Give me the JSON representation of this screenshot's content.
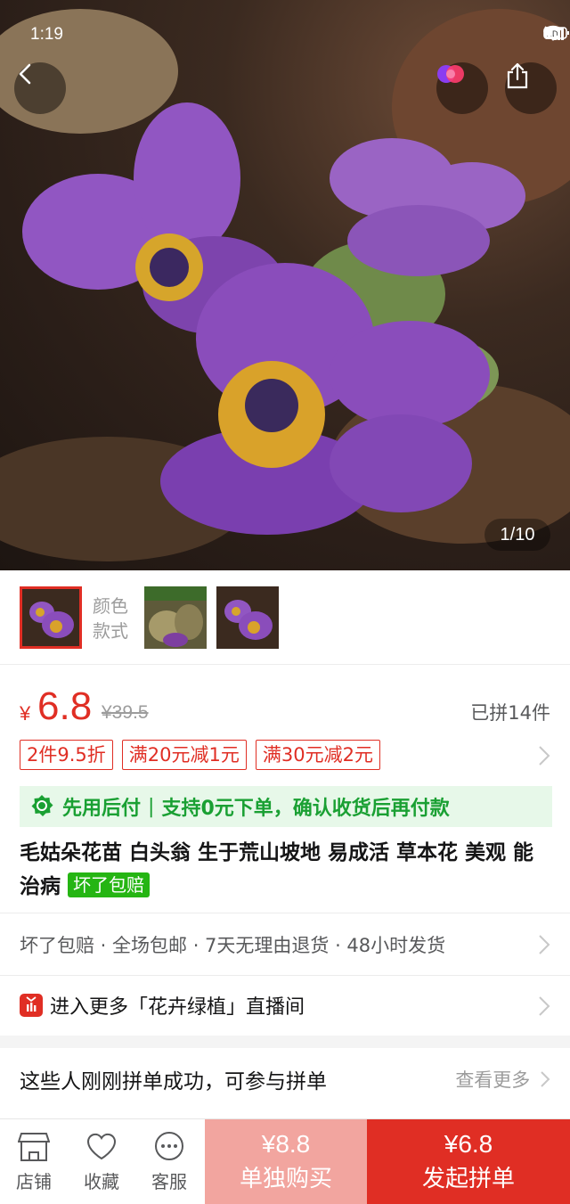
{
  "status_bar": {
    "time": "1:19"
  },
  "gallery": {
    "counter": "1/10"
  },
  "variant": {
    "label_line1": "颜色",
    "label_line2": "款式"
  },
  "price": {
    "currency": "¥",
    "current": "6.8",
    "original": "¥39.5",
    "sold": "已拼14件"
  },
  "promo_tags": [
    "2件9.5折",
    "满20元减1元",
    "满30元减2元"
  ],
  "pay_later": {
    "title": "先用后付",
    "desc": "支持0元下单，确认收货后再付款"
  },
  "product": {
    "title": "毛姑朵花苗 白头翁 生于荒山坡地 易成活 草本花 美观 能治病",
    "badge": "坏了包赔"
  },
  "services": "坏了包赔 · 全场包邮 · 7天无理由退货 · 48小时发货",
  "live_room": "进入更多「花卉绿植」直播间",
  "group_buy": {
    "title": "这些人刚刚拼单成功，可参与拼单",
    "see_more": "查看更多"
  },
  "bottom_bar": {
    "store": "店铺",
    "favorite": "收藏",
    "service": "客服",
    "buy_alone_price": "¥8.8",
    "buy_alone_label": "单独购买",
    "group_price": "¥6.8",
    "group_label": "发起拼单"
  },
  "colors": {
    "brand_red": "#e02e24",
    "pay_later_green": "#1aa033",
    "badge_green": "#25b513"
  }
}
